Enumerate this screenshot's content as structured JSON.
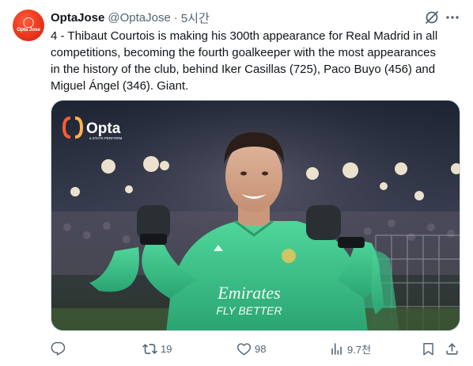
{
  "tweet": {
    "author": {
      "display_name": "OptaJose",
      "handle": "@OptaJose",
      "avatar_text": "Opta Jose"
    },
    "separator": "·",
    "timestamp": "5시간",
    "text": "4 - Thibaut Courtois is making his 300th appearance for Real Madrid in all\ncompetitions, becoming the fourth goalkeeper with the most appearances\nin the history of the club, behind Iker Casillas (725), Paco Buyo (456) and\nMiguel Ángel (346). Giant.",
    "media": {
      "watermark_text": "Opta",
      "watermark_subtext": "a STATS PERFORM",
      "shirt_sponsor": "Emirates",
      "shirt_sponsor_tagline": "FLY BETTER"
    },
    "actions": {
      "reply": {
        "icon": "reply-icon",
        "count": ""
      },
      "retweet": {
        "icon": "retweet-icon",
        "count": "19"
      },
      "like": {
        "icon": "heart-icon",
        "count": "98"
      },
      "views": {
        "icon": "views-icon",
        "count": "9.7천"
      },
      "bookmark": {
        "icon": "bookmark-icon"
      },
      "share": {
        "icon": "share-icon"
      }
    }
  },
  "colors": {
    "text_primary": "#0f1419",
    "text_secondary": "#536471",
    "avatar_bg": "#e8341c",
    "kit_green": "#3ec58c",
    "border": "#cfd9de"
  }
}
